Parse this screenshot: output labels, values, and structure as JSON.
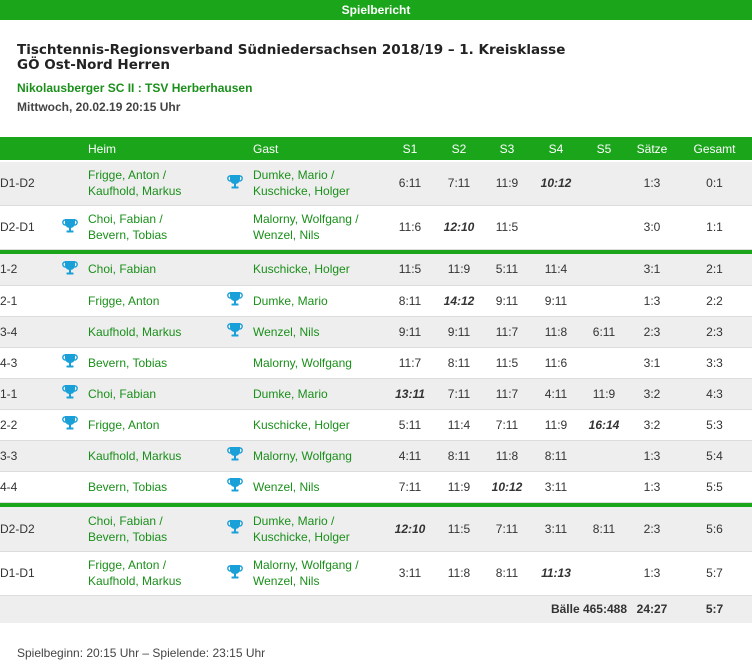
{
  "header": {
    "banner_title": "Spielbericht"
  },
  "info": {
    "league_line1": "Tischtennis-Regionsverband Südniedersachsen 2018/19 – 1. Kreisklasse",
    "league_line2": "GÖ Ost-Nord Herren",
    "teams": "Nikolausberger SC II : TSV Herberhausen",
    "date": "Mittwoch, 20.02.19 20:15 Uhr"
  },
  "table": {
    "headers": {
      "heim": "Heim",
      "gast": "Gast",
      "s1": "S1",
      "s2": "S2",
      "s3": "S3",
      "s4": "S4",
      "s5": "S5",
      "saetze": "Sätze",
      "gesamt": "Gesamt"
    },
    "groups": [
      {
        "rows": [
          {
            "pair": "D1-D2",
            "home": [
              "Frigge, Anton /",
              "Kaufhold, Markus"
            ],
            "guest": [
              "Dumke, Mario /",
              "Kuschicke, Holger"
            ],
            "winner": "guest",
            "sets": [
              "6:11",
              "7:11",
              "11:9",
              "10:12",
              ""
            ],
            "highlight": [
              3
            ],
            "saetze": "1:3",
            "gesamt": "0:1"
          },
          {
            "pair": "D2-D1",
            "home": [
              "Choi, Fabian /",
              "Bevern, Tobias"
            ],
            "guest": [
              "Malorny, Wolfgang /",
              "Wenzel, Nils"
            ],
            "winner": "home",
            "sets": [
              "11:6",
              "12:10",
              "11:5",
              "",
              ""
            ],
            "highlight": [
              1
            ],
            "saetze": "3:0",
            "gesamt": "1:1"
          }
        ]
      },
      {
        "rows": [
          {
            "pair": "1-2",
            "home": [
              "Choi, Fabian"
            ],
            "guest": [
              "Kuschicke, Holger"
            ],
            "winner": "home",
            "sets": [
              "11:5",
              "11:9",
              "5:11",
              "11:4",
              ""
            ],
            "highlight": [],
            "saetze": "3:1",
            "gesamt": "2:1"
          },
          {
            "pair": "2-1",
            "home": [
              "Frigge, Anton"
            ],
            "guest": [
              "Dumke, Mario"
            ],
            "winner": "guest",
            "sets": [
              "8:11",
              "14:12",
              "9:11",
              "9:11",
              ""
            ],
            "highlight": [
              1
            ],
            "saetze": "1:3",
            "gesamt": "2:2"
          },
          {
            "pair": "3-4",
            "home": [
              "Kaufhold, Markus"
            ],
            "guest": [
              "Wenzel, Nils"
            ],
            "winner": "guest",
            "sets": [
              "9:11",
              "9:11",
              "11:7",
              "11:8",
              "6:11"
            ],
            "highlight": [],
            "saetze": "2:3",
            "gesamt": "2:3"
          },
          {
            "pair": "4-3",
            "home": [
              "Bevern, Tobias"
            ],
            "guest": [
              "Malorny, Wolfgang"
            ],
            "winner": "home",
            "sets": [
              "11:7",
              "8:11",
              "11:5",
              "11:6",
              ""
            ],
            "highlight": [],
            "saetze": "3:1",
            "gesamt": "3:3"
          },
          {
            "pair": "1-1",
            "home": [
              "Choi, Fabian"
            ],
            "guest": [
              "Dumke, Mario"
            ],
            "winner": "home",
            "sets": [
              "13:11",
              "7:11",
              "11:7",
              "4:11",
              "11:9"
            ],
            "highlight": [
              0
            ],
            "saetze": "3:2",
            "gesamt": "4:3"
          },
          {
            "pair": "2-2",
            "home": [
              "Frigge, Anton"
            ],
            "guest": [
              "Kuschicke, Holger"
            ],
            "winner": "home",
            "sets": [
              "5:11",
              "11:4",
              "7:11",
              "11:9",
              "16:14"
            ],
            "highlight": [
              4
            ],
            "saetze": "3:2",
            "gesamt": "5:3"
          },
          {
            "pair": "3-3",
            "home": [
              "Kaufhold, Markus"
            ],
            "guest": [
              "Malorny, Wolfgang"
            ],
            "winner": "guest",
            "sets": [
              "4:11",
              "8:11",
              "11:8",
              "8:11",
              ""
            ],
            "highlight": [],
            "saetze": "1:3",
            "gesamt": "5:4"
          },
          {
            "pair": "4-4",
            "home": [
              "Bevern, Tobias"
            ],
            "guest": [
              "Wenzel, Nils"
            ],
            "winner": "guest",
            "sets": [
              "7:11",
              "11:9",
              "10:12",
              "3:11",
              ""
            ],
            "highlight": [
              2
            ],
            "saetze": "1:3",
            "gesamt": "5:5"
          }
        ]
      },
      {
        "rows": [
          {
            "pair": "D2-D2",
            "home": [
              "Choi, Fabian /",
              "Bevern, Tobias"
            ],
            "guest": [
              "Dumke, Mario /",
              "Kuschicke, Holger"
            ],
            "winner": "guest",
            "sets": [
              "12:10",
              "11:5",
              "7:11",
              "3:11",
              "8:11"
            ],
            "highlight": [
              0
            ],
            "saetze": "2:3",
            "gesamt": "5:6"
          },
          {
            "pair": "D1-D1",
            "home": [
              "Frigge, Anton /",
              "Kaufhold, Markus"
            ],
            "guest": [
              "Malorny, Wolfgang /",
              "Wenzel, Nils"
            ],
            "winner": "guest",
            "sets": [
              "3:11",
              "11:8",
              "8:11",
              "11:13",
              ""
            ],
            "highlight": [
              3
            ],
            "saetze": "1:3",
            "gesamt": "5:7"
          }
        ]
      }
    ],
    "summary": {
      "balls": "Bälle 465:488",
      "saetze": "24:27",
      "gesamt": "5:7"
    }
  },
  "footer": {
    "times": "Spielbeginn: 20:15 Uhr – Spielende: 23:15 Uhr"
  },
  "colors": {
    "accent": "#1ba51b",
    "player_link": "#1a8f1a",
    "trophy": "#19a0d8",
    "row_alt": "#eeeeee"
  },
  "icons": {
    "winner": "trophy-icon"
  }
}
